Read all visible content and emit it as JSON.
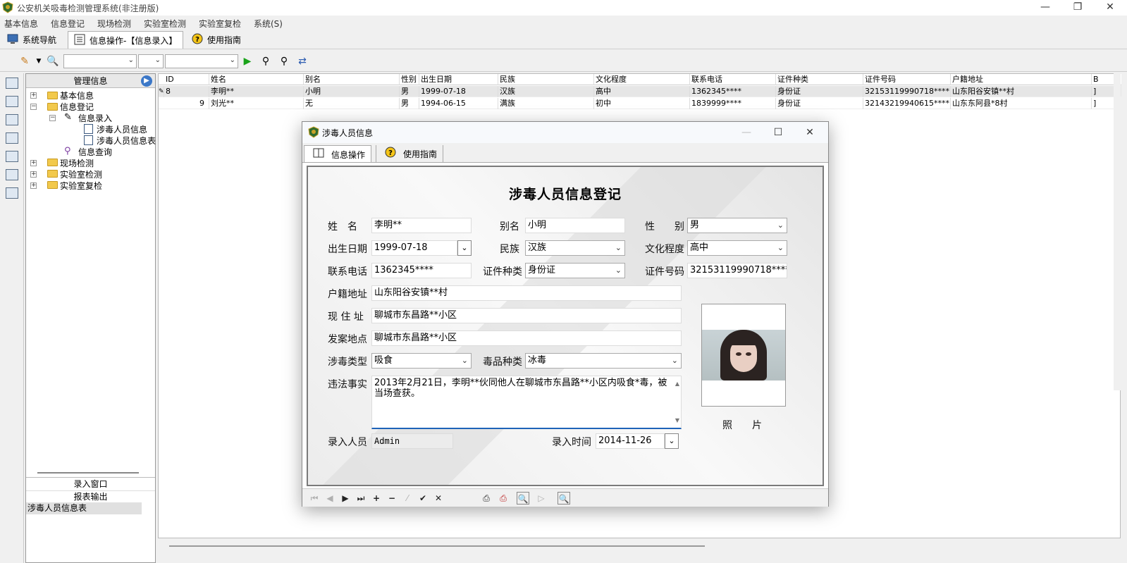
{
  "app": {
    "title": "公安机关吸毒检测管理系统(非注册版)"
  },
  "window_controls": {
    "minimize": "—",
    "restore": "❐",
    "close": "✕"
  },
  "menu": [
    "基本信息",
    "信息登记",
    "现场检测",
    "实验室检测",
    "实验室复检",
    "系统(S)"
  ],
  "tabs": [
    "系统导航",
    "信息操作-【信息录入】",
    "使用指南"
  ],
  "nav": {
    "header": "管理信息",
    "tree": [
      "基本信息",
      "信息登记",
      "信息录入",
      "涉毒人员信息",
      "涉毒人员信息表",
      "信息查询",
      "现场检测",
      "实验室检测",
      "实验室复检"
    ],
    "bottom": [
      "录入窗口",
      "报表输出",
      "涉毒人员信息表"
    ]
  },
  "grid": {
    "columns": [
      "ID",
      "姓名",
      "别名",
      "性别",
      "出生日期",
      "民族",
      "文化程度",
      "联系电话",
      "证件种类",
      "证件号码",
      "户籍地址",
      "B"
    ],
    "rows": [
      [
        "8",
        "李明**",
        "小明",
        "男",
        "1999-07-18",
        "汉族",
        "高中",
        "1362345****",
        "身份证",
        "32153119990718****",
        "山东阳谷安镇**村",
        "]"
      ],
      [
        "9",
        "刘光**",
        "无",
        "男",
        "1994-06-15",
        "满族",
        "初中",
        "1839999****",
        "身份证",
        "32143219940615****",
        "山东东阿县*8村",
        "]"
      ]
    ]
  },
  "dialog": {
    "title": "涉毒人员信息",
    "tabs": [
      "信息操作",
      "使用指南"
    ],
    "form_title": "涉毒人员信息登记",
    "labels": {
      "name": "姓　名",
      "alias": "别名",
      "gender": "性　　别",
      "birth": "出生日期",
      "ethnicity": "民族",
      "education": "文化程度",
      "phone": "联系电话",
      "id_type": "证件种类",
      "id_no": "证件号码",
      "hukou": "户籍地址",
      "address": "现 住 址",
      "incident_place": "发案地点",
      "drug_type": "涉毒类型",
      "drug_kind": "毒品种类",
      "facts": "违法事实",
      "operator": "录入人员",
      "entry_time": "录入时间",
      "photo": "照　　片"
    },
    "values": {
      "name": "李明**",
      "alias": "小明",
      "gender": "男",
      "birth": "1999-07-18",
      "ethnicity": "汉族",
      "education": "高中",
      "phone": "1362345****",
      "id_type": "身份证",
      "id_no": "32153119990718****",
      "hukou": "山东阳谷安镇**村",
      "address": "聊城市东昌路**小区",
      "incident_place": "聊城市东昌路**小区",
      "drug_type": "吸食",
      "drug_kind": "冰毒",
      "facts": "2013年2月21日，李明**伙同他人在聊城市东昌路**小区内吸食*毒，被当场查获。",
      "operator": "Admin",
      "entry_time": "2014-11-26"
    }
  }
}
